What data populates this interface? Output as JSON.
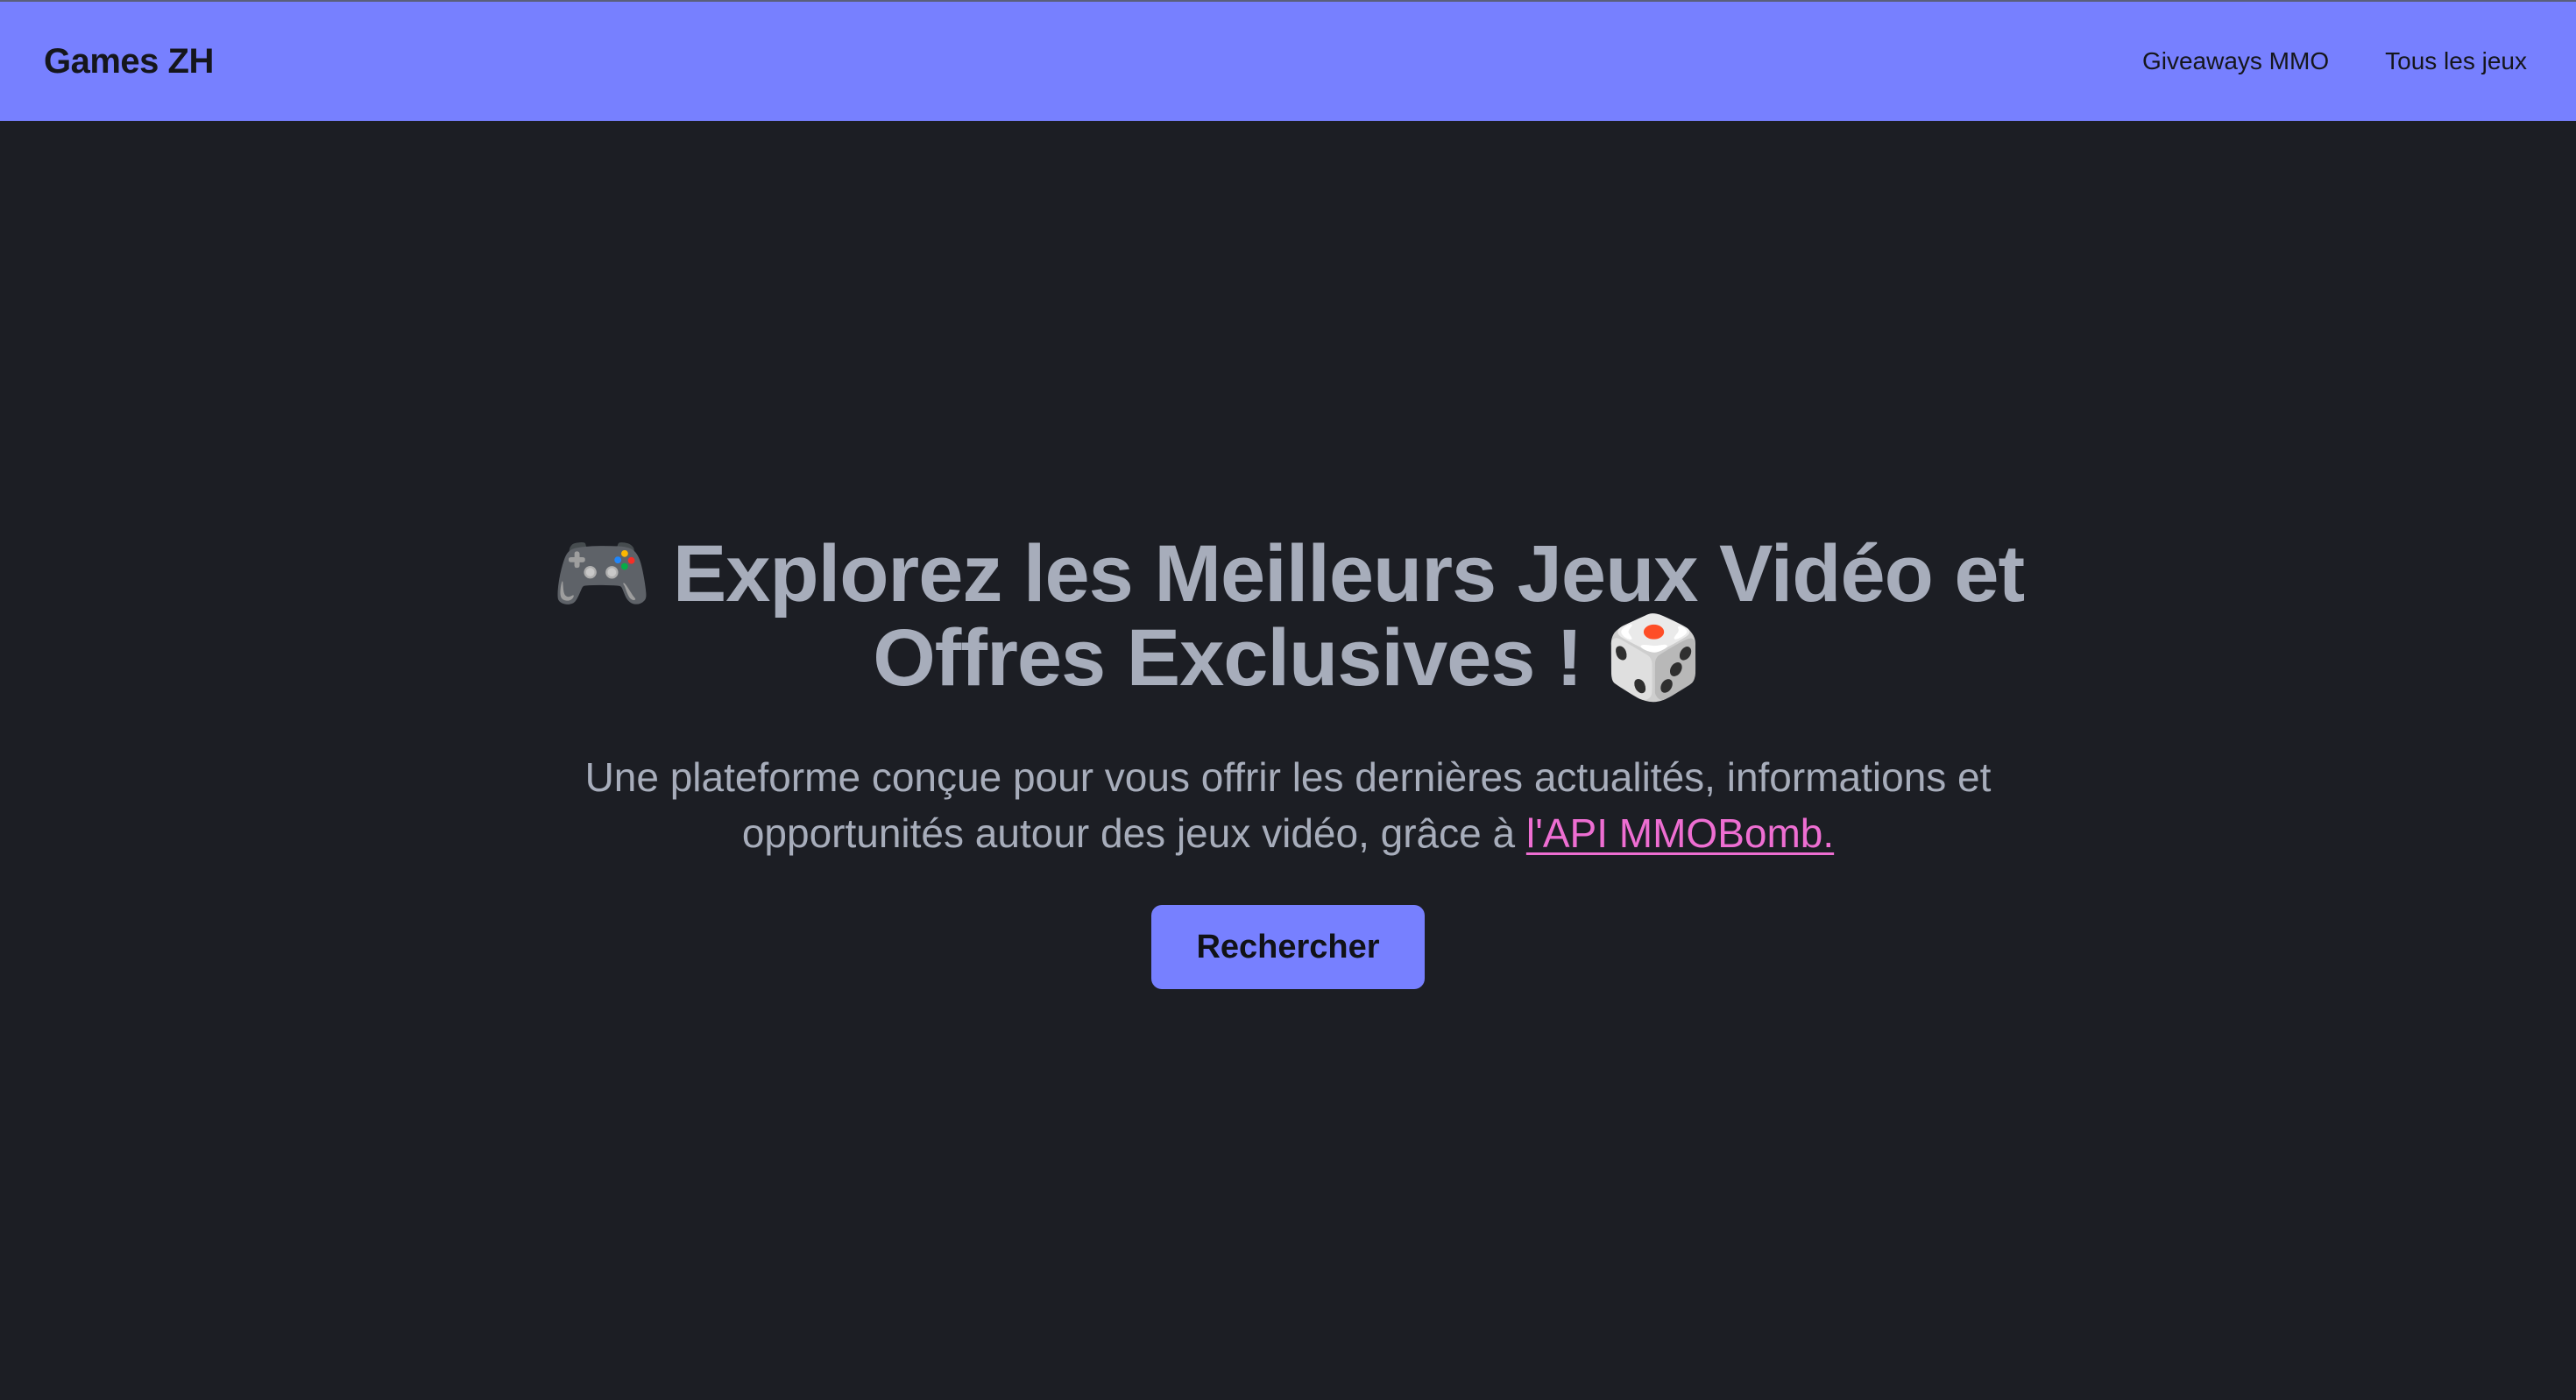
{
  "navbar": {
    "brand": "Games ZH",
    "links": [
      {
        "label": "Giveaways MMO"
      },
      {
        "label": "Tous les jeux"
      }
    ],
    "background_color": "#7780ff"
  },
  "hero": {
    "title_emoji_start": "🎮",
    "title_text": "Explorez les Meilleurs Jeux Vidéo et Offres Exclusives !",
    "title_emoji_end": "🎲",
    "text_before_link": "Une plateforme conçue pour vous offrir les dernières actualités, informations et opportunités autour des jeux vidéo, grâce à ",
    "link_text": "l'API MMOBomb.",
    "link_color": "#ee6ed2",
    "button_label": "Rechercher",
    "button_color": "#7780ff",
    "text_color": "#a7adbb",
    "background_color": "#1c1e24",
    "icons": {
      "start": "gamepad-icon",
      "end": "dice-icon"
    }
  }
}
